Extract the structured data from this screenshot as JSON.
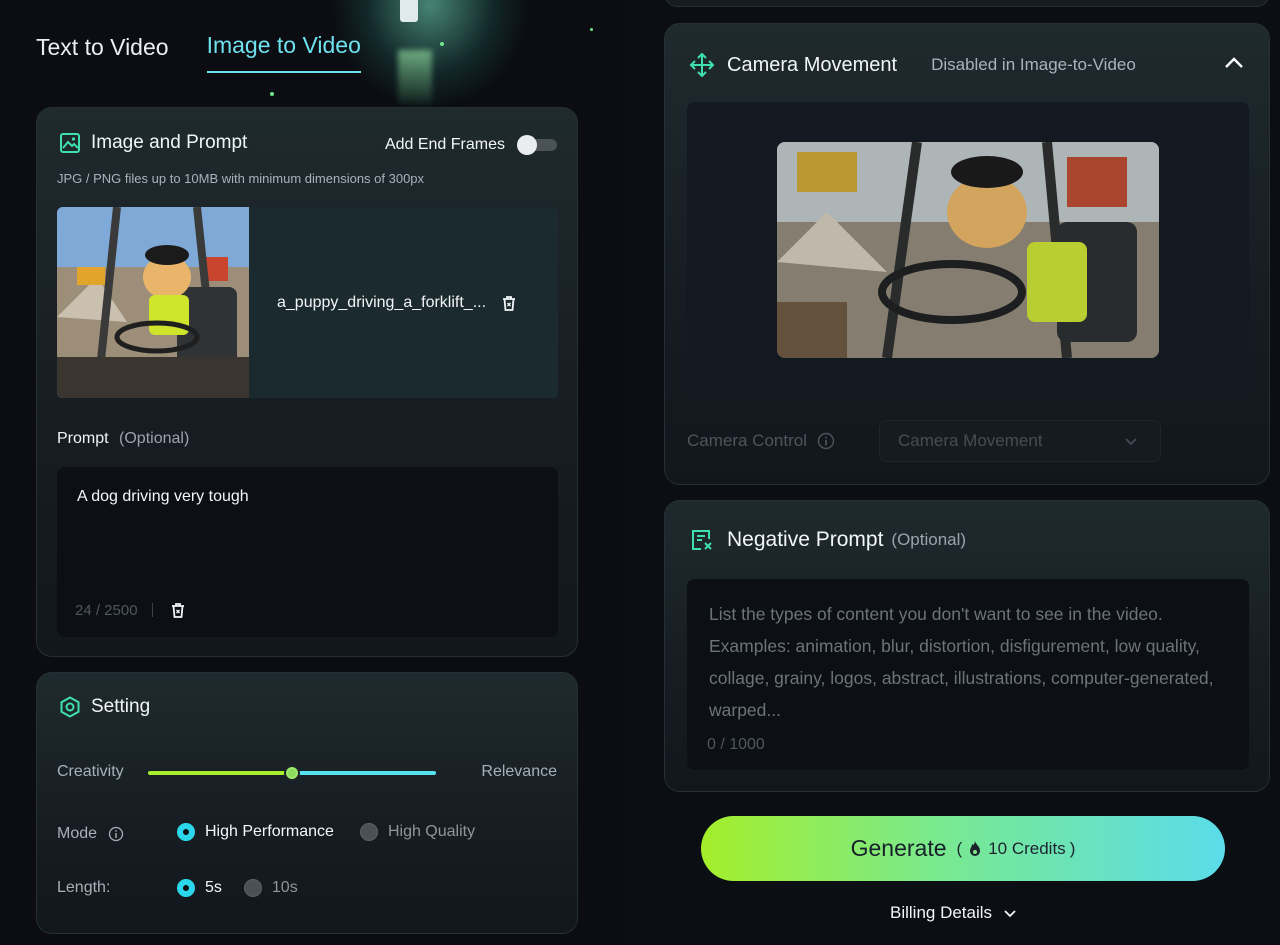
{
  "tabs": [
    {
      "label": "Text to Video",
      "active": false
    },
    {
      "label": "Image to Video",
      "active": true
    }
  ],
  "image_prompt": {
    "title": "Image and Prompt",
    "icon": "image-icon",
    "end_frames_label": "Add End Frames",
    "end_frames_on": false,
    "subtext": "JPG / PNG files up to 10MB with minimum dimensions of 300px",
    "file_name": "a_puppy_driving_a_forklift_...",
    "prompt_label": "Prompt",
    "prompt_optional": "(Optional)",
    "prompt_value": "A dog driving very tough",
    "char_count": "24 / 2500"
  },
  "setting": {
    "title": "Setting",
    "icon": "hexagon-settings-icon",
    "creativity_label": "Creativity",
    "relevance_label": "Relevance",
    "slider_value": 0.5,
    "mode_label": "Mode",
    "mode_options": [
      "High Performance",
      "High Quality"
    ],
    "mode_selected": "High Performance",
    "length_label": "Length:",
    "length_options": [
      "5s",
      "10s"
    ],
    "length_selected": "5s"
  },
  "camera": {
    "title": "Camera Movement",
    "note": "Disabled in Image-to-Video",
    "icon": "move-arrows-icon",
    "control_label": "Camera Control",
    "select_value": "Camera Movement"
  },
  "negative": {
    "title": "Negative Prompt",
    "optional": "(Optional)",
    "icon": "document-x-icon",
    "placeholder": "List the types of content you don't want to see in the video. Examples: animation, blur, distortion, disfigurement, low quality, collage, grainy, logos, abstract, illustrations, computer-generated, warped...",
    "count": "0 / 1000"
  },
  "generate": {
    "label": "Generate",
    "credits": "10 Credits"
  },
  "billing_label": "Billing Details",
  "colors": {
    "accent_cyan": "#6ee0ee",
    "accent_green": "#a4ee2a",
    "radio_on": "#2cd7ec"
  }
}
